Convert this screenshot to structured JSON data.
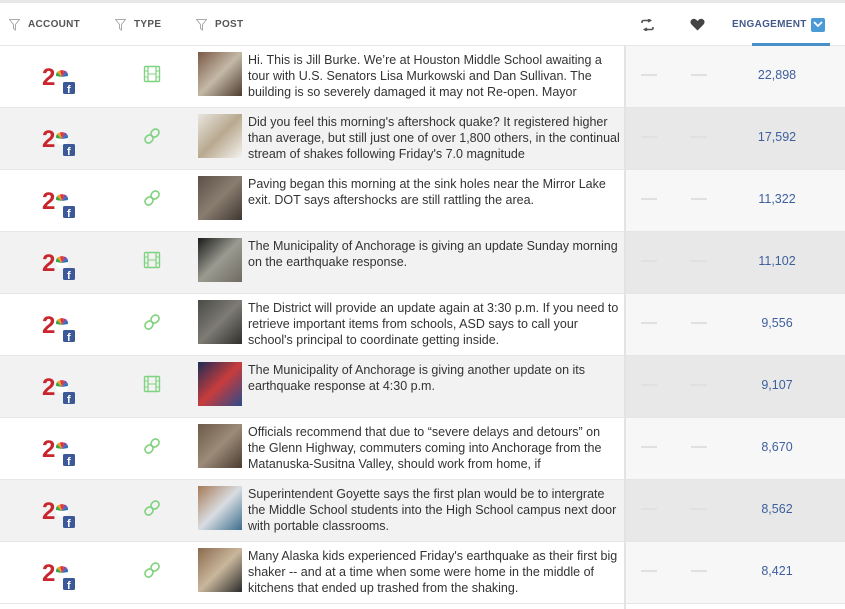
{
  "header": {
    "account": "ACCOUNT",
    "type": "TYPE",
    "post": "POST",
    "engagement": "ENGAGEMENT"
  },
  "icons": {
    "filter": "filter-icon",
    "retweet": "retweet-icon",
    "heart": "heart-icon",
    "sort": "chevron-down-icon",
    "video": "film-icon",
    "link": "link-icon",
    "logo": "channel-2-nbc-facebook-logo"
  },
  "colors": {
    "accent": "#4a9ad8",
    "engagement_text": "#3d5f9e",
    "type_icon": "#7fd27f"
  },
  "rows": [
    {
      "type": "video",
      "text": "Hi. This is Jill Burke. We’re at Houston Middle School awaiting a tour with U.S. Senators Lisa Murkowski and Dan Sullivan. The building is so severely damaged it may not Re-open. Mayor",
      "engagement": "22,898",
      "thumb": [
        "#7a5a46",
        "#c4b8a6",
        "#4d3b30"
      ]
    },
    {
      "type": "link",
      "text": "Did you feel this morning's aftershock quake? It registered higher than average, but still just one of over 1,800 others, in the continual stream of shakes following Friday's 7.0 magnitude",
      "engagement": "17,592",
      "thumb": [
        "#e9e5de",
        "#b8a98f",
        "#f5f2ee"
      ]
    },
    {
      "type": "link",
      "text": "Paving began this morning at the sink holes near the Mirror Lake exit. DOT says aftershocks are still rattling the area.",
      "engagement": "11,322",
      "thumb": [
        "#5b5048",
        "#8a7d70",
        "#3f3731"
      ]
    },
    {
      "type": "video",
      "text": "The Municipality of Anchorage is giving an update Sunday morning on the earthquake response.",
      "engagement": "11,102",
      "thumb": [
        "#1b1b1b",
        "#9a9a90",
        "#6f6a62"
      ]
    },
    {
      "type": "link",
      "text": "The District will provide an update again at 3:30 p.m. If you need to retrieve important items from schools, ASD says to call your school's principal to coordinate getting inside.",
      "engagement": "9,556",
      "thumb": [
        "#4a4a46",
        "#7d7b74",
        "#2f2f2c"
      ]
    },
    {
      "type": "video",
      "text": "The Municipality of Anchorage is giving another update on its earthquake response at 4:30 p.m.",
      "engagement": "9,107",
      "thumb": [
        "#1d2d55",
        "#c83c3c",
        "#2d4a8a"
      ]
    },
    {
      "type": "link",
      "text": "Officials recommend that due to “severe delays and detours” on the Glenn Highway, commuters coming into Anchorage from the Matanuska-Susitna Valley, should work from home, if",
      "engagement": "8,670",
      "thumb": [
        "#6d5a4a",
        "#9c8b78",
        "#4a3c31"
      ]
    },
    {
      "type": "link",
      "text": "Superintendent Goyette says the first plan would be to intergrate the Middle School students into the High School campus next door with portable classrooms.",
      "engagement": "8,562",
      "thumb": [
        "#a67a55",
        "#d9dde2",
        "#3a6d8c"
      ]
    },
    {
      "type": "link",
      "text": "Many Alaska kids experienced Friday's earthquake as their first big shaker -- and at a time when some were home in the middle of kitchens that ended up trashed from the shaking.",
      "engagement": "8,421",
      "thumb": [
        "#8a6a4d",
        "#c9b79c",
        "#2a2a2a"
      ]
    }
  ]
}
